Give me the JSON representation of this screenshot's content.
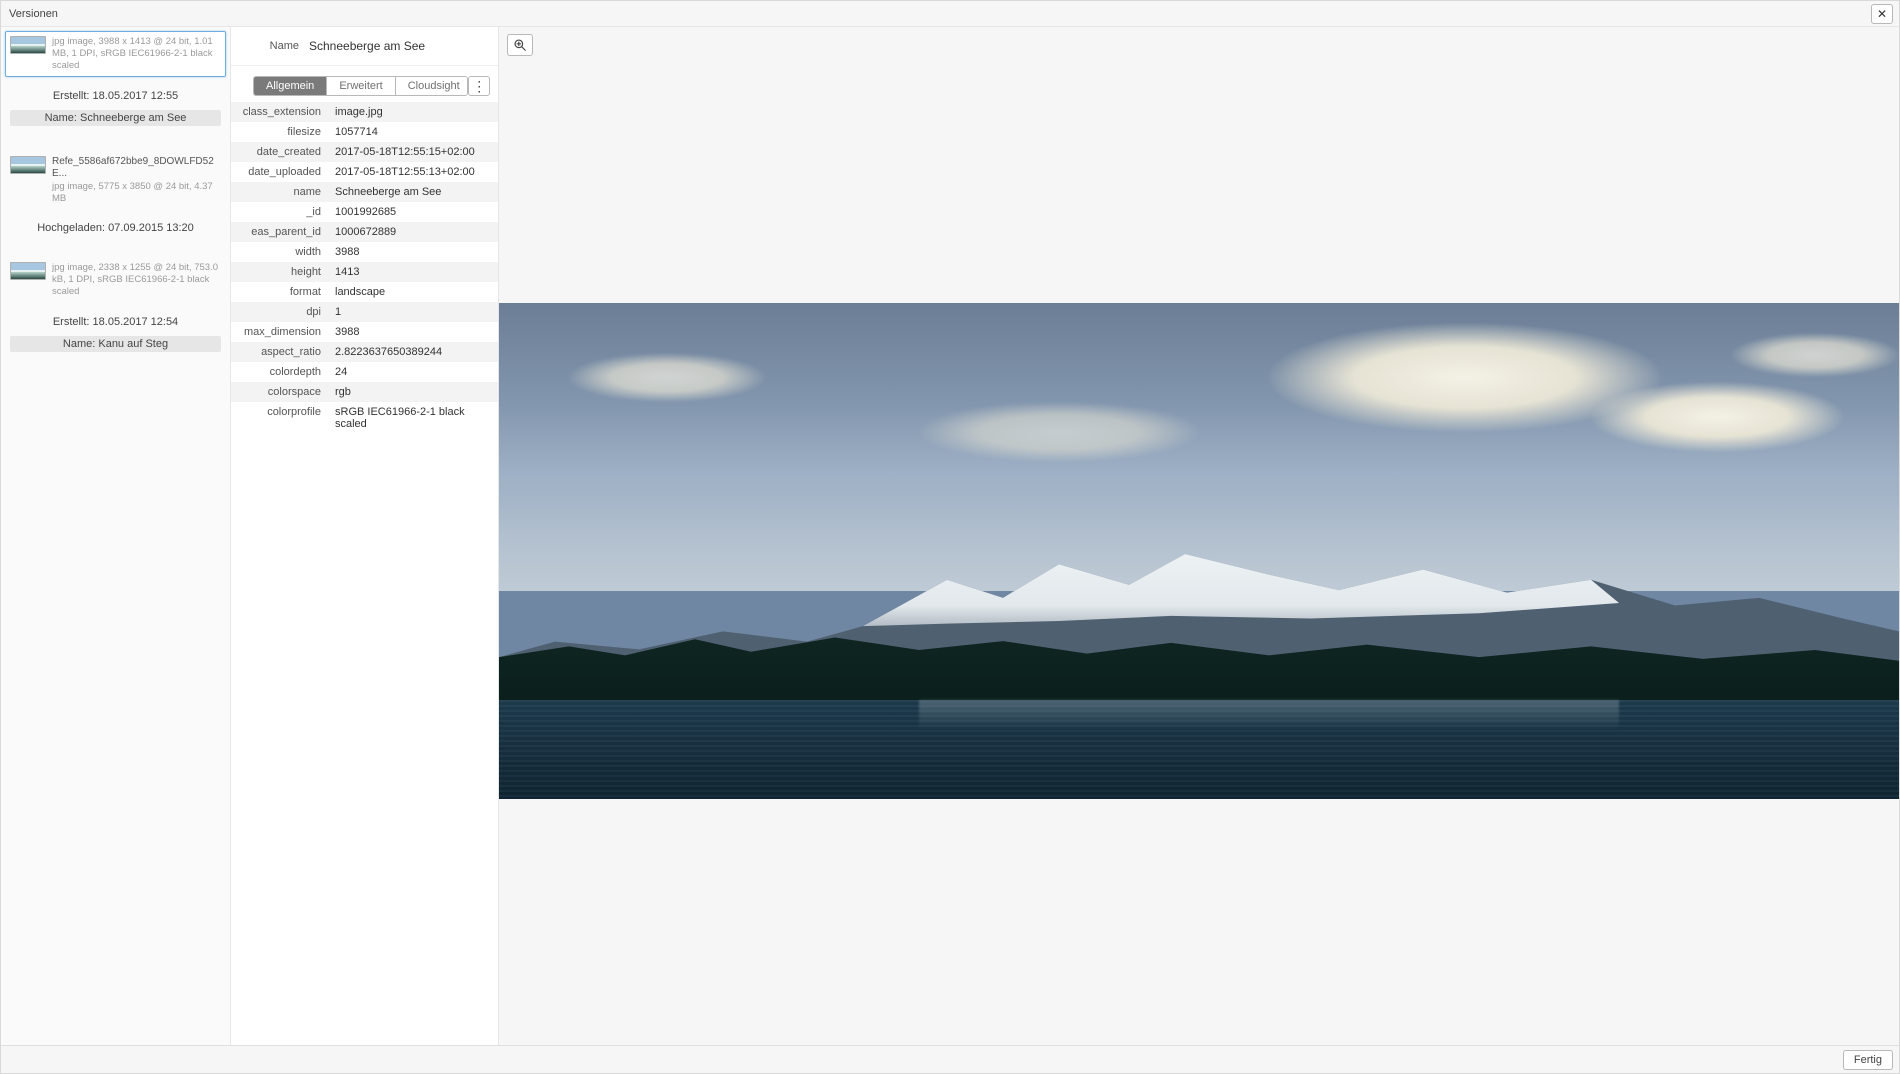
{
  "window": {
    "title": "Versionen"
  },
  "buttons": {
    "close": "✕",
    "done": "Fertig",
    "more": "⋮"
  },
  "sidebar": {
    "items": [
      {
        "filename_line": "jpg image,  3988 x 1413 @ 24 bit,  1.01 MB,  1 DPI,  sRGB IEC61966-2-1 black scaled",
        "created_line": "Erstellt: 18.05.2017 12:55",
        "name_line": "Name: Schneeberge am See",
        "selected": true
      },
      {
        "filename_line": "Refe_5586af672bbe9_8DOWLFD52E...",
        "meta_line": "jpg image,  5775 x 3850 @ 24 bit,  4.37 MB",
        "created_line": "Hochgeladen: 07.09.2015 13:20",
        "selected": false
      },
      {
        "filename_line": "jpg image,  2338 x 1255 @ 24 bit,  753.0 kB,  1 DPI,  sRGB IEC61966-2-1 black scaled",
        "created_line": "Erstellt: 18.05.2017 12:54",
        "name_line": "Name: Kanu auf Steg",
        "selected": false
      }
    ]
  },
  "details": {
    "name_label": "Name",
    "name_value": "Schneeberge am See",
    "tabs": [
      {
        "label": "Allgemein",
        "active": true
      },
      {
        "label": "Erweitert",
        "active": false
      },
      {
        "label": "Cloudsight",
        "active": false
      }
    ],
    "rows": [
      {
        "k": "class_extension",
        "v": "image.jpg"
      },
      {
        "k": "filesize",
        "v": "1057714"
      },
      {
        "k": "date_created",
        "v": "2017-05-18T12:55:15+02:00"
      },
      {
        "k": "date_uploaded",
        "v": "2017-05-18T12:55:13+02:00"
      },
      {
        "k": "name",
        "v": "Schneeberge am See"
      },
      {
        "k": "_id",
        "v": "1001992685"
      },
      {
        "k": "eas_parent_id",
        "v": "1000672889"
      },
      {
        "k": "width",
        "v": "3988"
      },
      {
        "k": "height",
        "v": "1413"
      },
      {
        "k": "format",
        "v": "landscape"
      },
      {
        "k": "dpi",
        "v": "1"
      },
      {
        "k": "max_dimension",
        "v": "3988"
      },
      {
        "k": "aspect_ratio",
        "v": "2.8223637650389244"
      },
      {
        "k": "colordepth",
        "v": "24"
      },
      {
        "k": "colorspace",
        "v": "rgb"
      },
      {
        "k": "colorprofile",
        "v": "sRGB IEC61966-2-1 black scaled"
      }
    ]
  }
}
